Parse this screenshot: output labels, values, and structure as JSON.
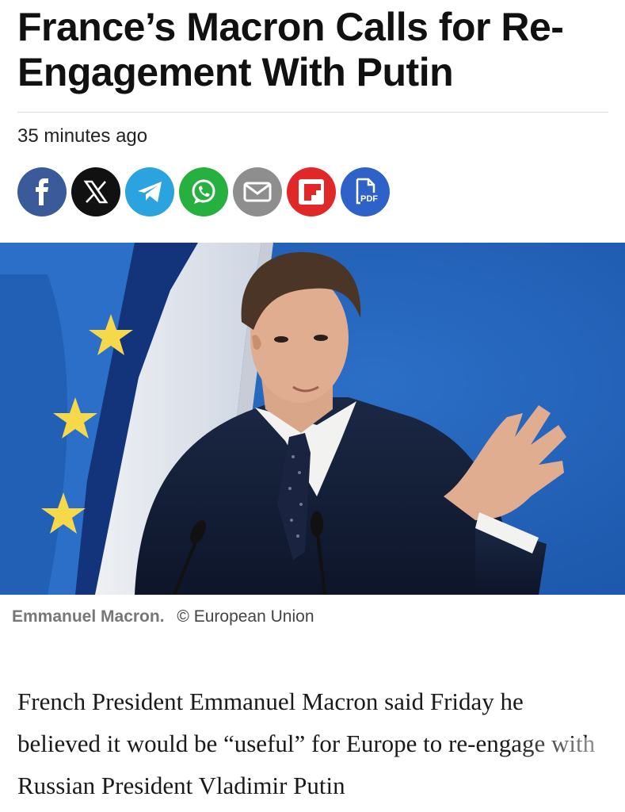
{
  "article": {
    "headline": "France’s Macron Calls for Re-Engagement With Putin",
    "timestamp": "35 minutes ago",
    "body": "French President Emmanuel Macron said Friday he believed it would be “useful” for Europe to re-engage with Russian President Vladimir Putin"
  },
  "share": {
    "buttons": [
      {
        "name": "facebook",
        "icon": "facebook-icon",
        "color": "#3b5a9a"
      },
      {
        "name": "x",
        "icon": "x-icon",
        "color": "#111111"
      },
      {
        "name": "telegram",
        "icon": "telegram-icon",
        "color": "#2aa3df"
      },
      {
        "name": "whatsapp",
        "icon": "whatsapp-icon",
        "color": "#25b03f"
      },
      {
        "name": "email",
        "icon": "email-icon",
        "color": "#8e8e8e"
      },
      {
        "name": "flipboard",
        "icon": "flipboard-icon",
        "color": "#e12828"
      },
      {
        "name": "pdf",
        "icon": "pdf-icon",
        "color": "#2f62c9"
      }
    ],
    "pdf_label": "PDF"
  },
  "photo": {
    "caption_name": "Emmanuel Macron.",
    "caption_credit": "© European Union"
  }
}
